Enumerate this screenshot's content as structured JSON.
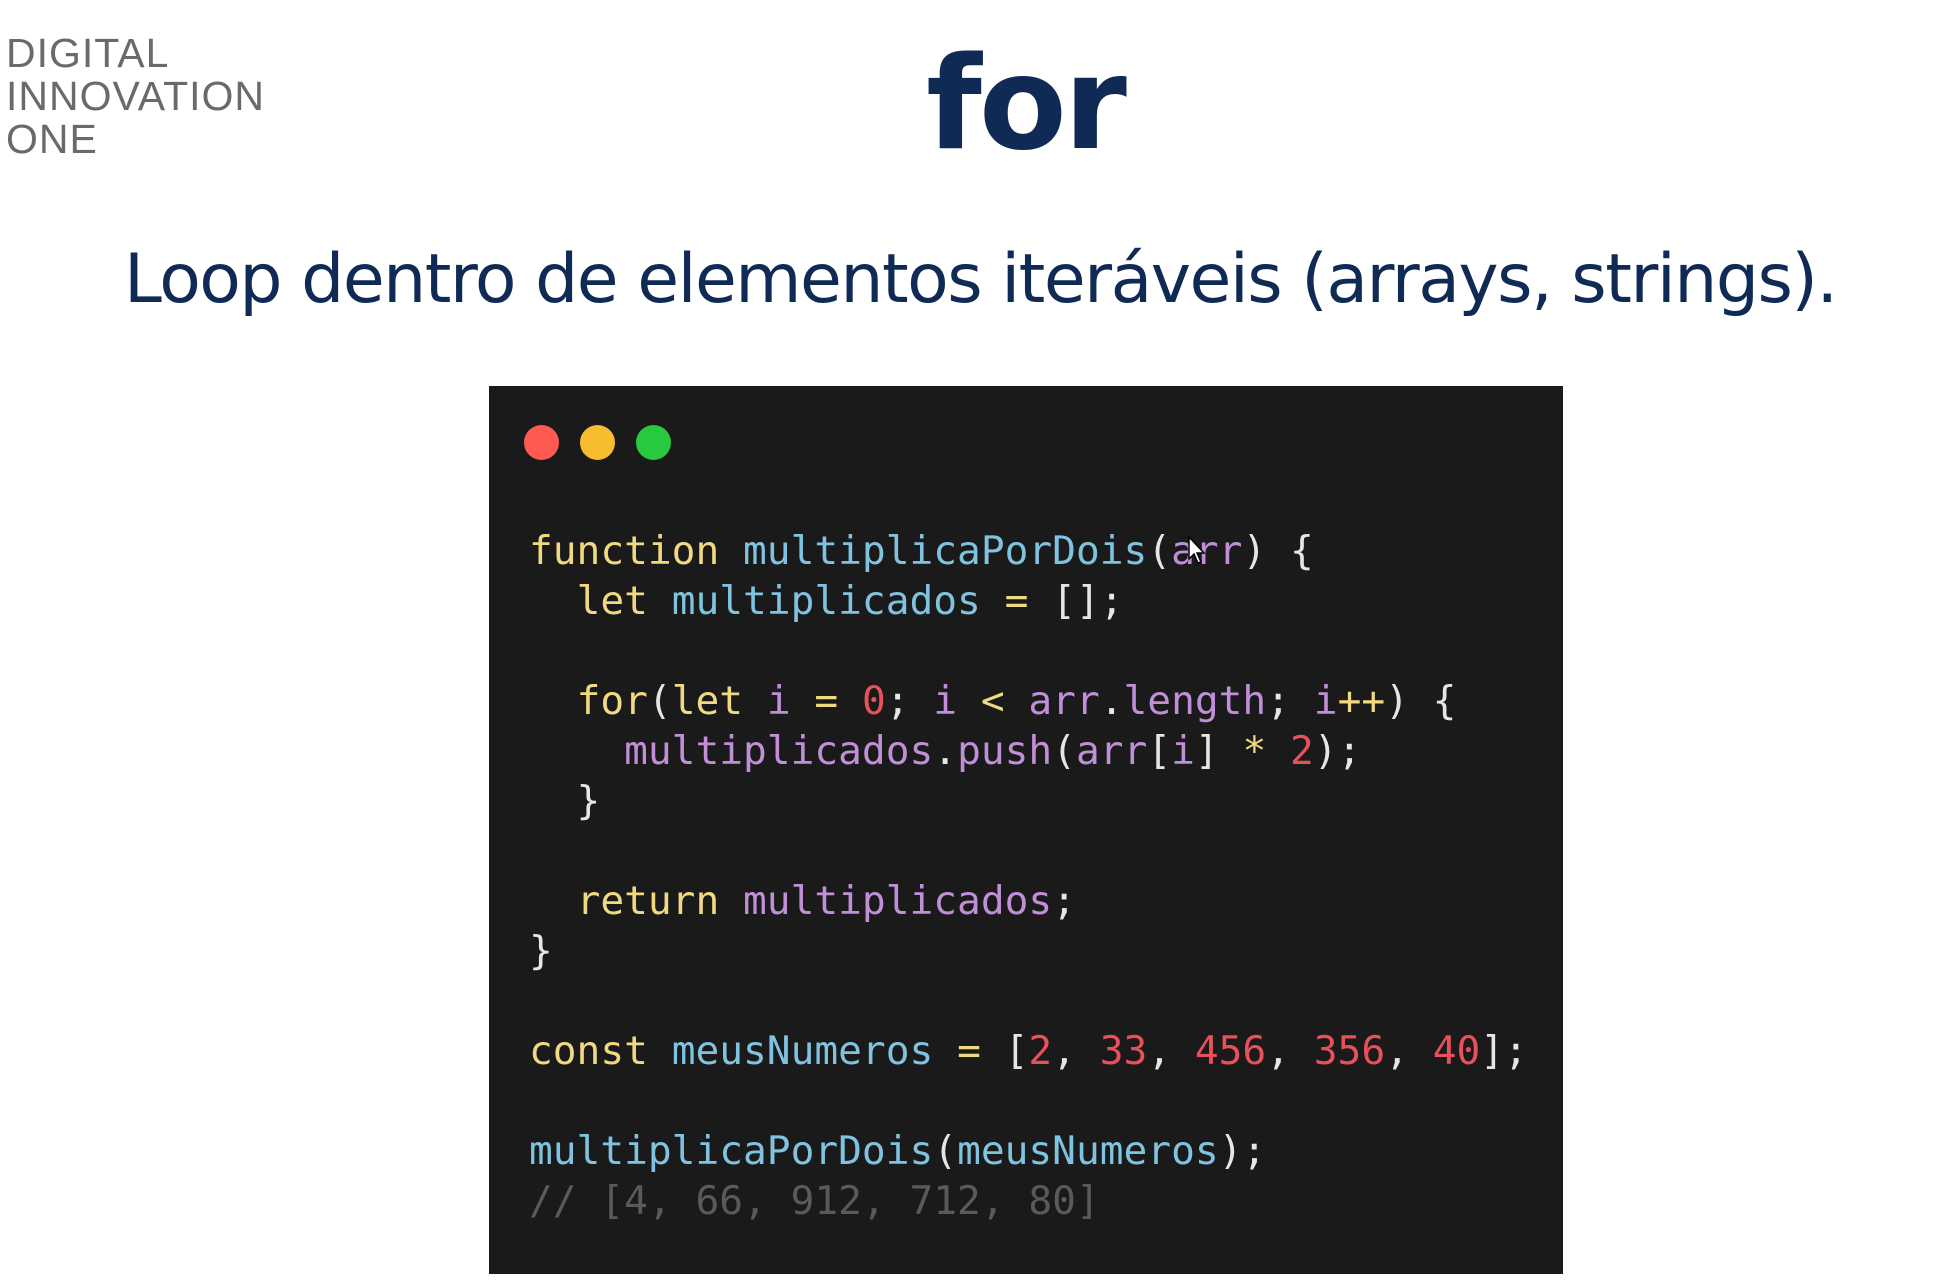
{
  "logo": {
    "line1": "DIGITAL",
    "line2": "INNOVATION",
    "line3": "ONE"
  },
  "slide": {
    "title": "for",
    "subtitle": "Loop dentro de elementos iteráveis (arrays, strings)."
  },
  "code_window": {
    "buttons": [
      "close",
      "minimize",
      "maximize"
    ],
    "lines": {
      "l1_kw": "function",
      "l1_fn": "multiplicaPorDois",
      "l1_param": "arr",
      "l2_kw": "let",
      "l2_var": "multiplicados",
      "l4_kw1": "for",
      "l4_kw2": "let",
      "l4_i1": "i",
      "l4_zero": "0",
      "l4_i2": "i",
      "l4_arr": "arr",
      "l4_len": "length",
      "l4_i3": "i",
      "l5_obj": "multiplicados",
      "l5_method": "push",
      "l5_arr": "arr",
      "l5_i": "i",
      "l5_two": "2",
      "l8_kw": "return",
      "l8_var": "multiplicados",
      "l11_kw": "const",
      "l11_var": "meusNumeros",
      "l11_n1": "2",
      "l11_n2": "33",
      "l11_n3": "456",
      "l11_n4": "356",
      "l11_n5": "40",
      "l13_fn": "multiplicaPorDois",
      "l13_arg": "meusNumeros",
      "l14_comment": "// [4, 66, 912, 712, 80]"
    }
  },
  "colors": {
    "title": "#102a56",
    "code_bg": "#1a1a1a",
    "keyword": "#f0d980",
    "function": "#7fc3e0",
    "variable": "#c08fd8",
    "number": "#e8505b",
    "comment": "#5a5a5a"
  }
}
